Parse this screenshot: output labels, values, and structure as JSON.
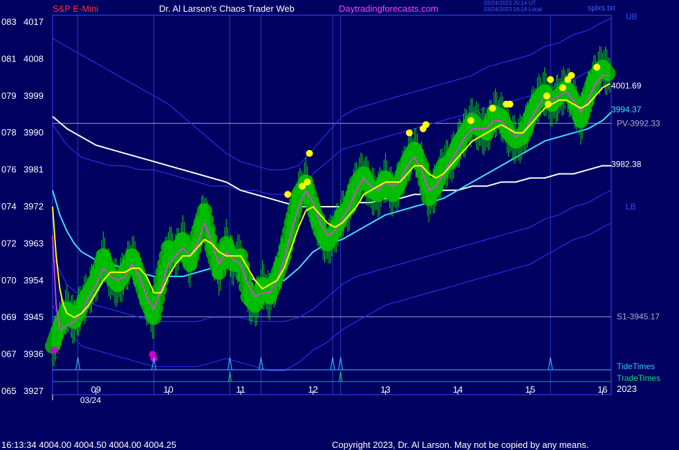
{
  "header": {
    "instrument": "S&P E-Mini",
    "title": "Dr. Al Larson's Chaos Trader Web",
    "site": "Daytradingforecasts.com",
    "timestamp_utc": "03/24/2023 20:14 UT",
    "timestamp_local": "03/24/2023 16:14 Local",
    "file_label": "splxs.txt"
  },
  "footer": {
    "quote": "16:13:34  4004.00 4004.50 4004.00 4004.25",
    "copyright": "Copyright 2023, Dr. Al Larson. May not be copied by any means."
  },
  "colors": {
    "background": "#000060",
    "frame": "#3050ff",
    "price_bars": "#00dd00",
    "fast_avg": "#e040e0",
    "slow_avg": "#ffff00",
    "cyan_avg": "#40e0ff",
    "white_avg": "#ffffff",
    "bands": "#2a2ae0",
    "markers_high": "#ffff00",
    "markers_low": "#cc00cc"
  },
  "chart_data": {
    "type": "line",
    "title": "S&P E-Mini",
    "y_axis_labels": [
      {
        "code": "083",
        "price": 4017
      },
      {
        "code": "081",
        "price": 4008
      },
      {
        "code": "079",
        "price": 3999
      },
      {
        "code": "078",
        "price": 3990
      },
      {
        "code": "076",
        "price": 3981
      },
      {
        "code": "074",
        "price": 3972
      },
      {
        "code": "072",
        "price": 3963
      },
      {
        "code": "070",
        "price": 3954
      },
      {
        "code": "069",
        "price": 3945
      },
      {
        "code": "067",
        "price": 3936
      },
      {
        "code": "065",
        "price": 3927
      }
    ],
    "ylim": [
      3927,
      4019
    ],
    "xlim": [
      8.4,
      16.12
    ],
    "x_ticks": [
      9,
      10,
      11,
      12,
      13,
      14,
      15,
      16
    ],
    "x_tick_labels": [
      "09",
      "10",
      "11",
      "12",
      "13",
      "14",
      "15",
      "16"
    ],
    "date_label": "03/24",
    "year_label": "2023",
    "hlines": [
      {
        "label": "PV-3992.33",
        "value": 3992.33
      },
      {
        "label": "S1-3945.17",
        "value": 3945.17
      }
    ],
    "value_labels": [
      {
        "label": "4001.69",
        "value": 4001.69,
        "color": "#ffffff"
      },
      {
        "label": "3994.37",
        "value": 3994.37,
        "color": "#40e0ff"
      },
      {
        "label": "3982.38",
        "value": 3982.38,
        "color": "#ffffff"
      }
    ],
    "band_labels": {
      "upper": "UB",
      "lower": "LB"
    },
    "tide_label": "TideTimes",
    "trade_label": "TradeTimes",
    "tide_times": [
      8.75,
      9.8,
      10.85,
      11.28,
      12.27,
      12.38,
      15.28
    ],
    "trade_times": [
      10.85,
      12.38
    ],
    "series": [
      {
        "key": "price",
        "x": [
          8.4,
          8.5,
          8.6,
          8.7,
          8.8,
          8.9,
          9.0,
          9.1,
          9.2,
          9.3,
          9.4,
          9.5,
          9.6,
          9.7,
          9.8,
          9.9,
          10.0,
          10.1,
          10.2,
          10.3,
          10.4,
          10.5,
          10.6,
          10.7,
          10.8,
          10.9,
          11.0,
          11.1,
          11.2,
          11.3,
          11.4,
          11.5,
          11.6,
          11.7,
          11.8,
          11.9,
          12.0,
          12.1,
          12.2,
          12.3,
          12.4,
          12.5,
          12.6,
          12.7,
          12.8,
          12.9,
          13.0,
          13.1,
          13.2,
          13.3,
          13.4,
          13.5,
          13.6,
          13.7,
          13.8,
          13.9,
          14.0,
          14.1,
          14.2,
          14.3,
          14.4,
          14.5,
          14.6,
          14.7,
          14.8,
          14.9,
          15.0,
          15.1,
          15.2,
          15.3,
          15.4,
          15.5,
          15.6,
          15.7,
          15.8,
          15.9,
          16.0,
          16.1
        ],
        "y": [
          3938,
          3943,
          3947,
          3944,
          3948,
          3951,
          3954,
          3960,
          3955,
          3953,
          3956,
          3960,
          3955,
          3949,
          3945,
          3954,
          3962,
          3960,
          3964,
          3958,
          3965,
          3971,
          3962,
          3956,
          3963,
          3958,
          3960,
          3950,
          3948,
          3953,
          3950,
          3955,
          3960,
          3968,
          3975,
          3978,
          3972,
          3966,
          3963,
          3966,
          3970,
          3972,
          3978,
          3980,
          3976,
          3975,
          3979,
          3975,
          3978,
          3983,
          3986,
          3982,
          3974,
          3977,
          3982,
          3983,
          3987,
          3990,
          3993,
          3991,
          3990,
          3995,
          3994,
          3990,
          3988,
          3989,
          3994,
          3998,
          4000,
          3997,
          3999,
          4001,
          3998,
          3993,
          3999,
          4004,
          4006,
          4004
        ]
      },
      {
        "key": "fast_avg",
        "x": [
          8.4,
          8.45,
          8.5,
          8.6,
          8.7,
          8.8,
          8.9,
          9.0,
          9.1,
          9.2,
          9.3,
          9.4,
          9.5,
          9.6,
          9.7,
          9.8,
          9.9,
          10.0,
          10.1,
          10.2,
          10.3,
          10.4,
          10.5,
          10.6,
          10.7,
          10.8,
          10.9,
          11.0,
          11.1,
          11.2,
          11.3,
          11.4,
          11.5,
          11.6,
          11.7,
          11.8,
          11.9,
          12.0,
          12.1,
          12.2,
          12.3,
          12.4,
          12.5,
          12.6,
          12.7,
          12.8,
          12.9,
          13.0,
          13.1,
          13.2,
          13.3,
          13.4,
          13.5,
          13.6,
          13.7,
          13.8,
          13.9,
          14.0,
          14.1,
          14.2,
          14.3,
          14.4,
          14.5,
          14.6,
          14.7,
          14.8,
          14.9,
          15.0,
          15.1,
          15.2,
          15.3,
          15.4,
          15.5,
          15.6,
          15.7,
          15.8,
          15.9,
          16.0,
          16.1
        ],
        "y": [
          3965,
          3948,
          3942,
          3943,
          3944,
          3946,
          3950,
          3953,
          3957,
          3955,
          3954,
          3955,
          3958,
          3955,
          3950,
          3947,
          3952,
          3958,
          3960,
          3962,
          3960,
          3963,
          3968,
          3963,
          3958,
          3961,
          3959,
          3958,
          3953,
          3950,
          3951,
          3951,
          3954,
          3959,
          3966,
          3972,
          3976,
          3973,
          3968,
          3965,
          3966,
          3969,
          3972,
          3976,
          3979,
          3977,
          3976,
          3978,
          3977,
          3978,
          3982,
          3984,
          3981,
          3976,
          3977,
          3980,
          3983,
          3986,
          3989,
          3991,
          3991,
          3991,
          3993,
          3993,
          3991,
          3989,
          3990,
          3993,
          3996,
          3999,
          3998,
          3999,
          4000,
          3998,
          3995,
          3998,
          4002,
          4004,
          4004
        ]
      },
      {
        "key": "slow_avg",
        "x": [
          8.4,
          8.45,
          8.5,
          8.55,
          8.6,
          8.7,
          8.8,
          8.9,
          9.0,
          9.1,
          9.2,
          9.3,
          9.4,
          9.5,
          9.6,
          9.7,
          9.8,
          9.9,
          10.0,
          10.1,
          10.2,
          10.3,
          10.4,
          10.5,
          10.6,
          10.7,
          10.8,
          10.9,
          11.0,
          11.1,
          11.2,
          11.3,
          11.4,
          11.5,
          11.6,
          11.7,
          11.8,
          11.9,
          12.0,
          12.1,
          12.2,
          12.3,
          12.4,
          12.5,
          12.6,
          12.7,
          12.8,
          12.9,
          13.0,
          13.1,
          13.2,
          13.3,
          13.4,
          13.5,
          13.6,
          13.7,
          13.8,
          13.9,
          14.0,
          14.1,
          14.2,
          14.3,
          14.4,
          14.5,
          14.6,
          14.7,
          14.8,
          14.9,
          15.0,
          15.1,
          15.2,
          15.3,
          15.4,
          15.5,
          15.6,
          15.7,
          15.8,
          15.9,
          16.0,
          16.1
        ],
        "y": [
          3972,
          3960,
          3952,
          3948,
          3946,
          3945,
          3946,
          3948,
          3951,
          3954,
          3956,
          3956,
          3956,
          3957,
          3957,
          3955,
          3951,
          3951,
          3955,
          3958,
          3960,
          3960,
          3962,
          3964,
          3963,
          3961,
          3960,
          3960,
          3960,
          3957,
          3954,
          3952,
          3953,
          3954,
          3957,
          3962,
          3967,
          3971,
          3972,
          3970,
          3968,
          3967,
          3968,
          3970,
          3972,
          3975,
          3976,
          3977,
          3978,
          3978,
          3978,
          3980,
          3982,
          3982,
          3980,
          3979,
          3980,
          3982,
          3984,
          3986,
          3988,
          3989,
          3990,
          3991,
          3992,
          3991,
          3990,
          3990,
          3992,
          3994,
          3996,
          3997,
          3998,
          3998,
          3997,
          3996,
          3997,
          3999,
          4001,
          4002
        ]
      },
      {
        "key": "cyan_avg",
        "x": [
          8.4,
          8.5,
          8.6,
          8.7,
          8.8,
          8.9,
          9.0,
          9.2,
          9.4,
          9.6,
          9.8,
          10.0,
          10.2,
          10.4,
          10.6,
          10.8,
          11.0,
          11.2,
          11.4,
          11.6,
          11.8,
          12.0,
          12.2,
          12.4,
          12.6,
          12.8,
          13.0,
          13.2,
          13.4,
          13.6,
          13.8,
          14.0,
          14.2,
          14.4,
          14.6,
          14.8,
          15.0,
          15.2,
          15.4,
          15.6,
          15.8,
          16.0,
          16.12
        ],
        "y": [
          3976,
          3970,
          3966,
          3963,
          3961,
          3960,
          3959,
          3958,
          3957,
          3956,
          3955,
          3955,
          3955,
          3956,
          3957,
          3957,
          3956,
          3954,
          3953,
          3954,
          3957,
          3961,
          3963,
          3964,
          3966,
          3968,
          3970,
          3971,
          3972,
          3973,
          3974,
          3976,
          3978,
          3980,
          3982,
          3984,
          3986,
          3988,
          3989,
          3990,
          3991,
          3993,
          3995
        ]
      },
      {
        "key": "white_avg",
        "x": [
          8.4,
          8.6,
          8.8,
          9.0,
          9.2,
          9.4,
          9.6,
          9.8,
          10.0,
          10.2,
          10.4,
          10.6,
          10.8,
          11.0,
          11.2,
          11.4,
          11.6,
          11.8,
          12.0,
          12.2,
          12.4,
          12.6,
          12.8,
          13.0,
          13.2,
          13.4,
          13.6,
          13.8,
          14.0,
          14.2,
          14.4,
          14.6,
          14.8,
          15.0,
          15.2,
          15.4,
          15.6,
          15.8,
          16.0,
          16.12
        ],
        "y": [
          3994,
          3991,
          3989,
          3987,
          3986,
          3985,
          3984,
          3983,
          3982,
          3981,
          3980,
          3979,
          3978,
          3976,
          3975,
          3974,
          3973,
          3972,
          3972,
          3972,
          3972,
          3973,
          3973,
          3974,
          3974,
          3975,
          3975,
          3976,
          3976,
          3977,
          3977,
          3978,
          3978,
          3979,
          3979,
          3980,
          3980,
          3981,
          3982,
          3982
        ]
      },
      {
        "key": "upper_band",
        "x": [
          8.4,
          8.6,
          8.8,
          9.0,
          9.2,
          9.4,
          9.6,
          9.8,
          10.0,
          10.2,
          10.4,
          10.6,
          10.8,
          11.0,
          11.2,
          11.4,
          11.6,
          11.8,
          12.0,
          12.2,
          12.4,
          12.6,
          12.8,
          13.0,
          13.2,
          13.4,
          13.6,
          13.8,
          14.0,
          14.2,
          14.4,
          14.6,
          14.8,
          15.0,
          15.2,
          15.4,
          15.6,
          15.8,
          16.0,
          16.12
        ],
        "y": [
          4013,
          4011,
          4009,
          4007,
          4005,
          4003,
          4001,
          3999,
          3997,
          3994,
          3991,
          3988,
          3985,
          3983,
          3982,
          3981,
          3981,
          3982,
          3986,
          3990,
          3994,
          3996,
          3997,
          3998,
          3999,
          4000,
          4001,
          4002,
          4003,
          4004,
          4006,
          4007,
          4008,
          4009,
          4011,
          4012,
          4014,
          4015,
          4017,
          4018
        ]
      },
      {
        "key": "upper_inner",
        "x": [
          8.4,
          8.6,
          8.8,
          9.0,
          9.2,
          9.4,
          9.6,
          9.8,
          10.0,
          10.2,
          10.4,
          10.6,
          10.8,
          11.0,
          11.2,
          11.4,
          11.6,
          11.8,
          12.0,
          12.2,
          12.4,
          12.6,
          12.8,
          13.0,
          13.2,
          13.4,
          13.6,
          13.8,
          14.0,
          14.2,
          14.4,
          14.6,
          14.8,
          15.0,
          15.2,
          15.4,
          15.6,
          15.8,
          16.0,
          16.12
        ],
        "y": [
          3992,
          3987,
          3984,
          3983,
          3982,
          3982,
          3981,
          3981,
          3980,
          3979,
          3978,
          3977,
          3977,
          3976,
          3976,
          3975,
          3975,
          3976,
          3980,
          3983,
          3986,
          3987,
          3988,
          3989,
          3990,
          3991,
          3992,
          3993,
          3994,
          3995,
          3996,
          3997,
          3998,
          3999,
          4000,
          4002,
          4003,
          4005,
          4006,
          4007
        ]
      },
      {
        "key": "lower_band",
        "x": [
          8.4,
          8.6,
          8.8,
          9.0,
          9.2,
          9.4,
          9.6,
          9.8,
          10.0,
          10.2,
          10.4,
          10.6,
          10.8,
          11.0,
          11.2,
          11.4,
          11.6,
          11.8,
          12.0,
          12.2,
          12.4,
          12.6,
          12.8,
          13.0,
          13.2,
          13.4,
          13.6,
          13.8,
          14.0,
          14.2,
          14.4,
          14.6,
          14.8,
          15.0,
          15.2,
          15.4,
          15.6,
          15.8,
          16.0,
          16.12
        ],
        "y": [
          3948,
          3942,
          3938,
          3937,
          3936,
          3935,
          3934,
          3933,
          3933,
          3933,
          3933,
          3934,
          3935,
          3934,
          3933,
          3932,
          3932,
          3934,
          3937,
          3939,
          3942,
          3944,
          3946,
          3948,
          3949,
          3950,
          3951,
          3952,
          3953,
          3954,
          3955,
          3956,
          3957,
          3958,
          3960,
          3962,
          3964,
          3965,
          3967,
          3968
        ]
      },
      {
        "key": "lower_inner",
        "x": [
          8.4,
          8.6,
          8.8,
          9.0,
          9.2,
          9.4,
          9.6,
          9.8,
          10.0,
          10.2,
          10.4,
          10.6,
          10.8,
          11.0,
          11.2,
          11.4,
          11.6,
          11.8,
          12.0,
          12.2,
          12.4,
          12.6,
          12.8,
          13.0,
          13.2,
          13.4,
          13.6,
          13.8,
          14.0,
          14.2,
          14.4,
          14.6,
          14.8,
          15.0,
          15.2,
          15.4,
          15.6,
          15.8,
          16.0,
          16.12
        ],
        "y": [
          3960,
          3953,
          3950,
          3948,
          3947,
          3946,
          3945,
          3944,
          3944,
          3944,
          3944,
          3945,
          3945,
          3945,
          3944,
          3944,
          3944,
          3945,
          3947,
          3950,
          3953,
          3955,
          3956,
          3957,
          3958,
          3959,
          3960,
          3961,
          3962,
          3963,
          3964,
          3965,
          3966,
          3967,
          3969,
          3970,
          3972,
          3973,
          3975,
          3976
        ]
      }
    ],
    "high_markers": {
      "x": [
        11.65,
        11.85,
        11.92,
        11.95,
        13.33,
        13.52,
        13.56,
        14.18,
        14.48,
        14.67,
        14.72,
        15.23,
        15.25,
        15.28,
        15.45,
        15.52,
        15.57,
        15.92
      ],
      "y": [
        3975,
        3977,
        3978,
        3985,
        3990,
        3991,
        3992,
        3993,
        3996,
        3997,
        3997,
        3999,
        3997,
        4003,
        4001,
        4003,
        4004,
        4006
      ]
    },
    "low_markers": {
      "x": [
        8.42,
        9.78,
        9.8
      ],
      "y": [
        3937,
        3936,
        3935
      ]
    }
  }
}
